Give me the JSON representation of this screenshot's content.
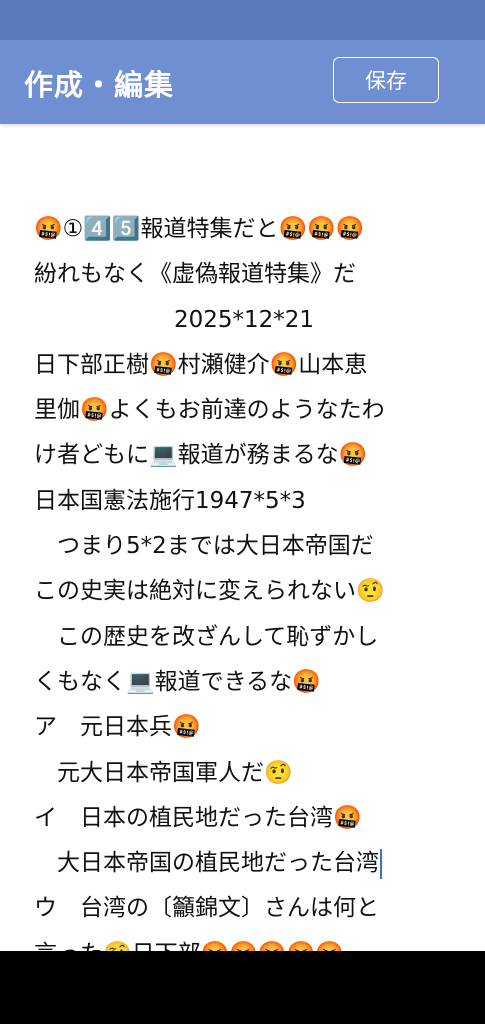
{
  "app_bar": {
    "title": "作成・編集",
    "save_label": "保存"
  },
  "editor": {
    "lines": [
      "🤬①4️⃣5️⃣報道特集だと🤬🤬🤬",
      "紛れもなく《虚偽報道特集》だ",
      "2025*12*21",
      "日下部正樹🤬村瀬健介🤬山本恵",
      "里伽🤬よくもお前達のようなたわ",
      "け者どもに💻報道が務まるな🤬",
      "日本国憲法施行1947*5*3",
      "　つまり5*2までは大日本帝国だ",
      "この史実は絶対に変えられない🤨",
      "　この歴史を改ざんして恥ずかし",
      "くもなく💻報道できるな🤬",
      "ア　元日本兵🤬",
      "　元大日本帝国軍人だ🤨",
      "イ　日本の植民地だった台湾🤬",
      "　大日本帝国の植民地だった台湾",
      "ウ　台湾の〔籲錦文〕さんは何と",
      "言った🤨日下部🤬🤬🤬🤬🤬"
    ]
  }
}
